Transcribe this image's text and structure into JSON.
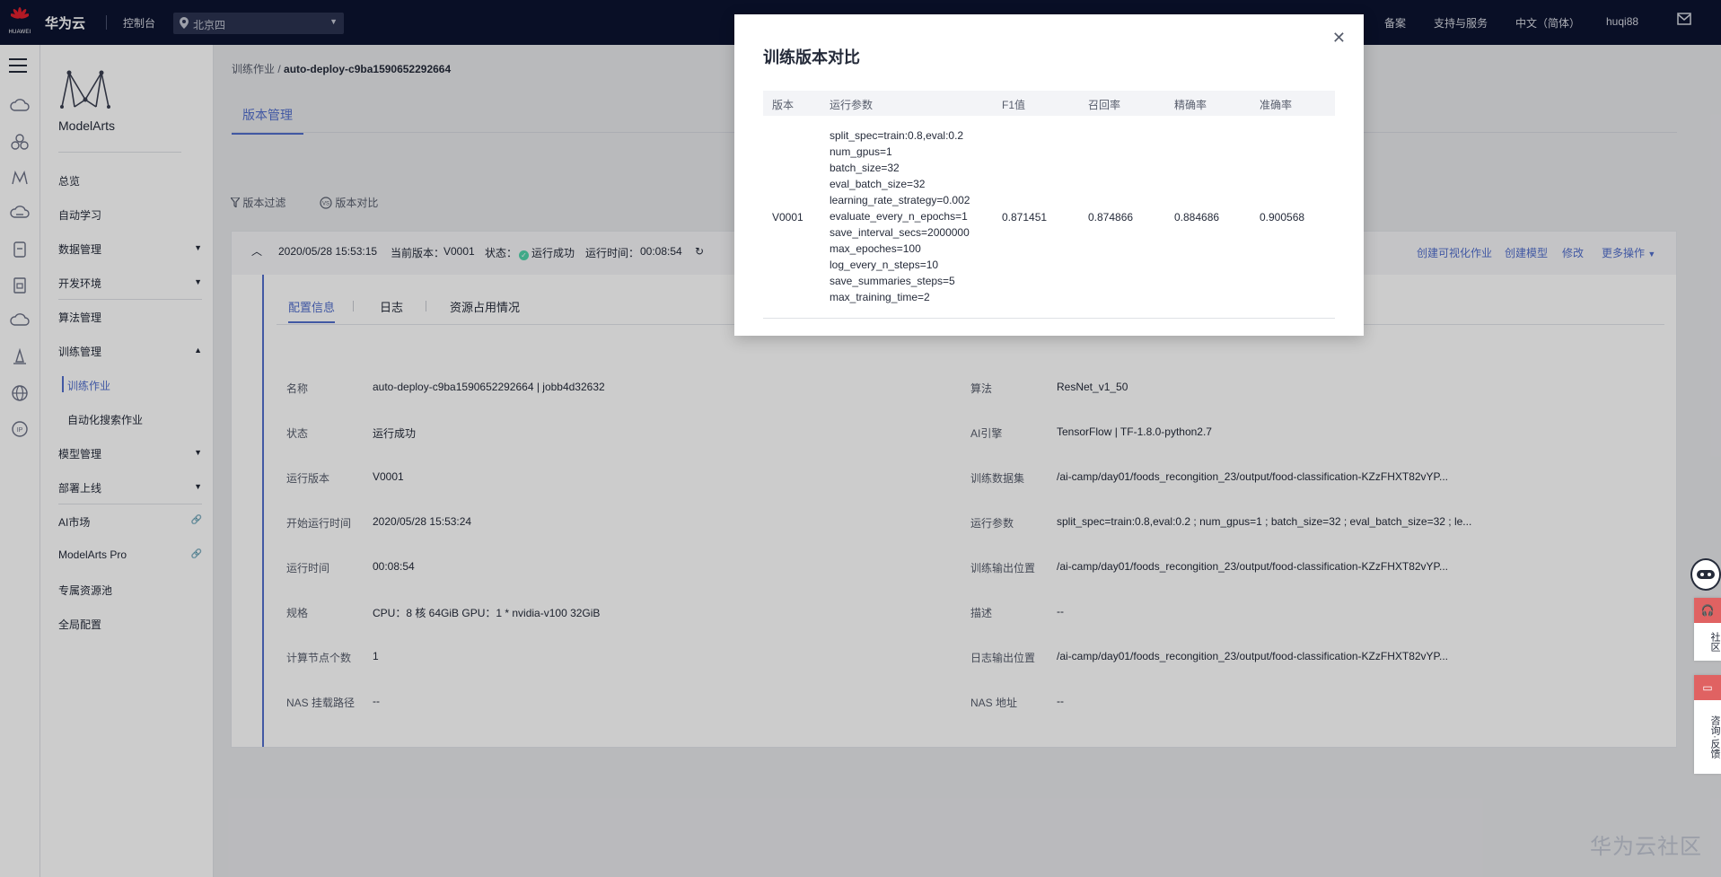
{
  "topbar": {
    "logo_text": "HUAWEI",
    "brand": "华为云",
    "console": "控制台",
    "region": "北京四",
    "links": [
      "备案",
      "支持与服务",
      "中文（简体）",
      "huqi88"
    ]
  },
  "sidebar": {
    "product_name": "ModelArts",
    "items": [
      {
        "label": "总览"
      },
      {
        "label": "自动学习"
      },
      {
        "label": "数据管理"
      },
      {
        "label": "开发环境"
      },
      {
        "label": "算法管理"
      },
      {
        "label": "训练管理"
      },
      {
        "label": "训练作业"
      },
      {
        "label": "自动化搜索作业"
      },
      {
        "label": "模型管理"
      },
      {
        "label": "部署上线"
      },
      {
        "label": "AI市场"
      },
      {
        "label": "ModelArts Pro"
      },
      {
        "label": "专属资源池"
      },
      {
        "label": "全局配置"
      }
    ]
  },
  "breadcrumb": {
    "parent": "训练作业",
    "separator": "/",
    "current": "auto-deploy-c9ba1590652292664"
  },
  "main": {
    "tab": "版本管理",
    "filter_label": "版本过滤",
    "compare_label": "版本对比"
  },
  "version_card": {
    "date": "2020/05/28 15:53:15",
    "version_label": "当前版本：",
    "version": "V0001",
    "status_label": "状态：",
    "status": "运行成功",
    "runtime_label": "运行时间：",
    "runtime": "00:08:54",
    "actions": [
      "创建可视化作业",
      "创建模型",
      "修改",
      "更多操作"
    ],
    "tabs": [
      "配置信息",
      "日志",
      "资源占用情况"
    ],
    "left_fields": [
      {
        "label": "名称",
        "value": "auto-deploy-c9ba1590652292664 | jobb4d32632"
      },
      {
        "label": "状态",
        "value": "运行成功"
      },
      {
        "label": "运行版本",
        "value": "V0001"
      },
      {
        "label": "开始运行时间",
        "value": "2020/05/28 15:53:24"
      },
      {
        "label": "运行时间",
        "value": "00:08:54"
      },
      {
        "label": "规格",
        "value": "CPU：8 核 64GiB GPU：1 * nvidia-v100 32GiB"
      },
      {
        "label": "计算节点个数",
        "value": "1"
      },
      {
        "label": "NAS 挂载路径",
        "value": "--"
      }
    ],
    "right_fields": [
      {
        "label": "算法",
        "value": "ResNet_v1_50"
      },
      {
        "label": "AI引擎",
        "value": "TensorFlow | TF-1.8.0-python2.7"
      },
      {
        "label": "训练数据集",
        "value": "/ai-camp/day01/foods_recongition_23/output/food-classification-KZzFHXT82vYP..."
      },
      {
        "label": "运行参数",
        "value": "split_spec=train:0.8,eval:0.2 ; num_gpus=1 ; batch_size=32 ; eval_batch_size=32 ; le..."
      },
      {
        "label": "训练输出位置",
        "value": "/ai-camp/day01/foods_recongition_23/output/food-classification-KZzFHXT82vYP..."
      },
      {
        "label": "描述",
        "value": "--"
      },
      {
        "label": "日志输出位置",
        "value": "/ai-camp/day01/foods_recongition_23/output/food-classification-KZzFHXT82vYP..."
      },
      {
        "label": "NAS 地址",
        "value": "--"
      }
    ]
  },
  "modal": {
    "title": "训练版本对比",
    "columns": [
      "版本",
      "运行参数",
      "F1值",
      "召回率",
      "精确率",
      "准确率"
    ],
    "row": {
      "version": "V0001",
      "params": [
        "split_spec=train:0.8,eval:0.2",
        "num_gpus=1",
        "batch_size=32",
        "eval_batch_size=32",
        "learning_rate_strategy=0.002",
        "evaluate_every_n_epochs=1",
        "save_interval_secs=2000000",
        "max_epoches=100",
        "log_every_n_steps=10",
        "save_summaries_steps=5",
        "max_training_time=2"
      ],
      "f1": "0.871451",
      "recall": "0.874866",
      "precision": "0.884686",
      "accuracy": "0.900568"
    }
  },
  "float": {
    "community": "社区",
    "consult_feedback": "咨询·反馈"
  },
  "watermark": "华为云社区",
  "colors": {
    "accent": "#526ecc",
    "topbar": "#0c1330",
    "success": "#50d4ab",
    "float_red": "#e06262"
  }
}
